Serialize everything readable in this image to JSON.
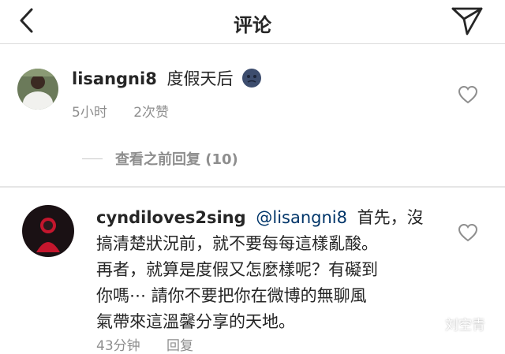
{
  "header": {
    "title": "评论"
  },
  "comments": [
    {
      "username": "lisangni8",
      "text": "度假天后",
      "time": "5小时",
      "likes": "2次赞"
    },
    {
      "username": "cyndiloves2sing",
      "mention": "@lisangni8",
      "line1": "首先，沒",
      "line2": "搞清楚狀況前，就不要每每這樣亂酸。",
      "line3": "再者，就算是度假又怎麼樣呢？有礙到",
      "line4": "你嗎⋯ 請你不要把你在微博的無聊風",
      "line5": "氣帶來這溫馨分享的天地。",
      "time": "43分钟",
      "reply": "回复"
    }
  ],
  "view_replies": {
    "label": "查看之前回复 (10)"
  },
  "watermark": {
    "text": "刘空青"
  },
  "icons": {
    "back": "chevron-left-icon",
    "share": "paper-plane-icon",
    "emoji": "cold-face-emoji-icon",
    "like": "heart-icon"
  }
}
